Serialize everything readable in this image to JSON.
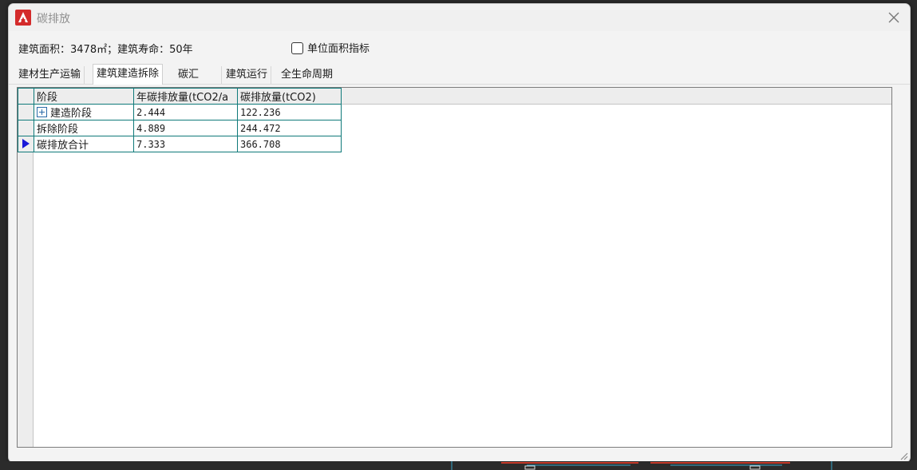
{
  "window": {
    "title": "碳排放"
  },
  "info": {
    "summary": "建筑面积：3478㎡；建筑寿命：50年",
    "checkbox_label": "单位面积指标",
    "checkbox_checked": false
  },
  "tabs": [
    {
      "label": "建材生产运输",
      "active": false
    },
    {
      "label": "建筑建造拆除",
      "active": true
    },
    {
      "label": "碳汇",
      "active": false
    },
    {
      "label": "建筑运行",
      "active": false
    },
    {
      "label": "全生命周期",
      "active": false
    }
  ],
  "grid": {
    "columns": [
      "阶段",
      "年碳排放量(tCO2/a",
      "碳排放量(tCO2)"
    ],
    "rows": [
      {
        "stage": "建造阶段",
        "annual": "2.444",
        "total": "122.236",
        "expandable": true,
        "current": false
      },
      {
        "stage": "拆除阶段",
        "annual": "4.889",
        "total": "244.472",
        "expandable": false,
        "current": false
      },
      {
        "stage": "碳排放合计",
        "annual": "7.333",
        "total": "366.708",
        "expandable": false,
        "current": true
      }
    ]
  },
  "colors": {
    "grid_border": "#0f7a7a",
    "row_pointer": "#1818d8",
    "app_icon": "#d42b2b"
  },
  "icons": {
    "app": "autocad-logo-icon",
    "close": "close-icon",
    "expand": "plus-box-icon",
    "current_row": "row-pointer-icon",
    "resize": "resize-grip-icon"
  }
}
